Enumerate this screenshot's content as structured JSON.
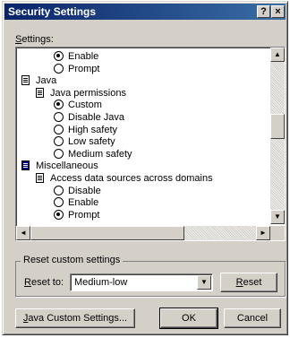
{
  "window": {
    "title": "Security Settings",
    "help_label": "?",
    "close_label": "×"
  },
  "settings_label_prefix": "S",
  "settings_label_rest": "ettings:",
  "tree": [
    {
      "kind": "radio",
      "label": "Enable",
      "selected": true
    },
    {
      "kind": "radio",
      "label": "Prompt",
      "selected": false
    },
    {
      "kind": "folder",
      "label": "Java"
    },
    {
      "kind": "folder",
      "label": "Java permissions"
    },
    {
      "kind": "radio",
      "label": "Custom",
      "selected": true
    },
    {
      "kind": "radio",
      "label": "Disable Java",
      "selected": false
    },
    {
      "kind": "radio",
      "label": "High safety",
      "selected": false
    },
    {
      "kind": "radio",
      "label": "Low safety",
      "selected": false
    },
    {
      "kind": "radio",
      "label": "Medium safety",
      "selected": false
    },
    {
      "kind": "folder",
      "label": "Miscellaneous"
    },
    {
      "kind": "folder",
      "label": "Access data sources across domains"
    },
    {
      "kind": "radio",
      "label": "Disable",
      "selected": false
    },
    {
      "kind": "radio",
      "label": "Enable",
      "selected": false
    },
    {
      "kind": "radio",
      "label": "Prompt",
      "selected": true
    }
  ],
  "reset_group": {
    "title": "Reset custom settings",
    "reset_to_prefix": "R",
    "reset_to_rest": "eset to:",
    "combo_value": "Medium-low",
    "reset_button_prefix": "R",
    "reset_button_rest": "eset"
  },
  "buttons": {
    "java_custom_prefix": "J",
    "java_custom_rest": "ava Custom Settings...",
    "ok": "OK",
    "cancel": "Cancel"
  },
  "icons": {
    "radio": "radio-button",
    "folder": "settings-folder-icon",
    "scroll_up": "▲",
    "scroll_down": "▼",
    "scroll_left": "◄",
    "scroll_right": "►",
    "combo_drop": "▼"
  }
}
